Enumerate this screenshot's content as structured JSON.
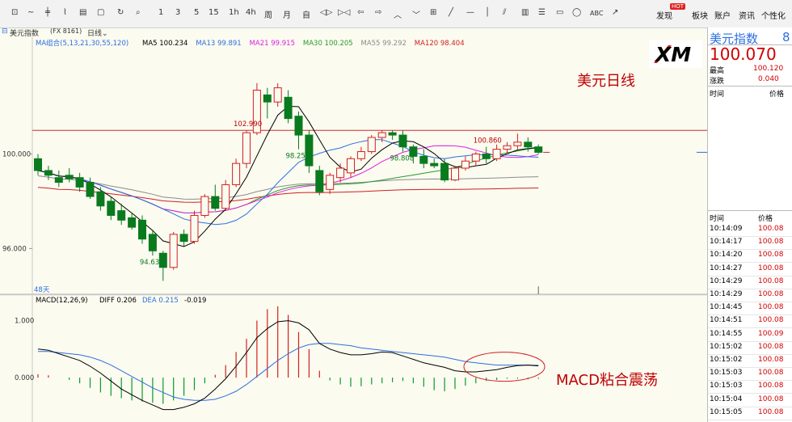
{
  "toolbar": {
    "tools": [
      "1",
      "3",
      "5",
      "15",
      "1h",
      "4h",
      "周",
      "月",
      "自"
    ],
    "abc": "ABC",
    "right": {
      "discover": "发现",
      "hot": "HOT",
      "board": "板块",
      "account": "账户",
      "news": "资讯",
      "personal": "个性化"
    }
  },
  "instrument": {
    "name": "美元指数",
    "code": "(FX 8161)",
    "period": "日线"
  },
  "legend": {
    "group_label": "MA组合(5,13,21,30,55,120)",
    "items": [
      {
        "label": "MA5 100.234",
        "color": "#000000"
      },
      {
        "label": "MA13 99.891",
        "color": "#2c6fe0"
      },
      {
        "label": "MA21 99.915",
        "color": "#e020e0"
      },
      {
        "label": "MA30 100.205",
        "color": "#2a9a2a"
      },
      {
        "label": "MA55 99.292",
        "color": "#8c8c8c"
      },
      {
        "label": "MA120 98.404",
        "color": "#d02020"
      }
    ]
  },
  "macd_legend": {
    "label": "MACD(12,26,9)",
    "diff": "DIFF 0.206",
    "dea": "DEA 0.215",
    "macd": "-0.019"
  },
  "bar_count": "48天",
  "annotations": {
    "daily": "美元日线",
    "macd": "MACD粘合震荡",
    "xm_logo": "XM"
  },
  "right_panel": {
    "title": "美元指数",
    "code": "8",
    "price": "100.070",
    "high_label": "最高",
    "high_value": "100.120",
    "change_label": "涨跌",
    "change_value": "0.040",
    "time_header": "时间",
    "price_header": "价格",
    "ticks": [
      {
        "time": "10:14:09",
        "price": "100.08"
      },
      {
        "time": "10:14:17",
        "price": "100.08"
      },
      {
        "time": "10:14:20",
        "price": "100.08"
      },
      {
        "time": "10:14:27",
        "price": "100.08"
      },
      {
        "time": "10:14:29",
        "price": "100.08"
      },
      {
        "time": "10:14:29",
        "price": "100.08"
      },
      {
        "time": "10:14:45",
        "price": "100.08"
      },
      {
        "time": "10:14:51",
        "price": "100.08"
      },
      {
        "time": "10:14:55",
        "price": "100.09"
      },
      {
        "time": "10:15:02",
        "price": "100.08"
      },
      {
        "time": "10:15:02",
        "price": "100.08"
      },
      {
        "time": "10:15:03",
        "price": "100.08"
      },
      {
        "time": "10:15:03",
        "price": "100.08"
      },
      {
        "time": "10:15:04",
        "price": "100.08"
      },
      {
        "time": "10:15:05",
        "price": "100.08"
      }
    ]
  },
  "chart_data": [
    {
      "type": "candlestick",
      "title": "美元指数 日线",
      "y_ticks": [
        "100.000",
        "96.000"
      ],
      "ylim": [
        94.2,
        104.6
      ],
      "reference_line": {
        "value": 101.0,
        "color": "#c83030"
      },
      "up_color": "#d42020",
      "down_color": "#0a7a1e",
      "price_labels": [
        {
          "text": "102.990",
          "index": 20
        },
        {
          "text": "98.255",
          "index": 25
        },
        {
          "text": "100.860",
          "index": 43
        },
        {
          "text": "98.808",
          "index": 35
        },
        {
          "text": "94.632",
          "index": 11
        }
      ],
      "candles": [
        {
          "o": 99.8,
          "h": 100.0,
          "c": 99.3,
          "l": 99.1
        },
        {
          "o": 99.3,
          "h": 99.5,
          "c": 99.1,
          "l": 98.9
        },
        {
          "o": 99.0,
          "h": 99.3,
          "c": 98.8,
          "l": 98.6
        },
        {
          "o": 99.1,
          "h": 99.4,
          "c": 98.95,
          "l": 98.8
        },
        {
          "o": 99.0,
          "h": 99.2,
          "c": 98.6,
          "l": 98.4
        },
        {
          "o": 98.8,
          "h": 99.0,
          "c": 98.2,
          "l": 98.1
        },
        {
          "o": 98.4,
          "h": 98.6,
          "c": 97.8,
          "l": 97.6
        },
        {
          "o": 98.0,
          "h": 98.2,
          "c": 97.4,
          "l": 97.2
        },
        {
          "o": 97.6,
          "h": 97.9,
          "c": 97.2,
          "l": 97.0
        },
        {
          "o": 97.3,
          "h": 97.5,
          "c": 96.9,
          "l": 96.8
        },
        {
          "o": 97.2,
          "h": 97.4,
          "c": 96.4,
          "l": 96.2
        },
        {
          "o": 96.6,
          "h": 96.8,
          "c": 95.9,
          "l": 95.7
        },
        {
          "o": 95.8,
          "h": 95.9,
          "c": 95.2,
          "l": 94.632
        },
        {
          "o": 95.2,
          "h": 96.7,
          "c": 96.6,
          "l": 95.1
        },
        {
          "o": 96.6,
          "h": 96.8,
          "c": 96.3,
          "l": 96.1
        },
        {
          "o": 96.3,
          "h": 97.6,
          "c": 97.4,
          "l": 96.2
        },
        {
          "o": 97.4,
          "h": 98.3,
          "c": 98.2,
          "l": 97.3
        },
        {
          "o": 98.2,
          "h": 98.7,
          "c": 97.7,
          "l": 97.6
        },
        {
          "o": 97.7,
          "h": 98.9,
          "c": 98.7,
          "l": 97.6
        },
        {
          "o": 98.7,
          "h": 99.8,
          "c": 99.6,
          "l": 98.6
        },
        {
          "o": 99.6,
          "h": 101.0,
          "c": 100.9,
          "l": 99.4
        },
        {
          "o": 100.9,
          "h": 103.0,
          "c": 102.7,
          "l": 100.8
        },
        {
          "o": 102.5,
          "h": 102.8,
          "c": 102.2,
          "l": 101.5
        },
        {
          "o": 102.2,
          "h": 102.99,
          "c": 102.8,
          "l": 102.0
        },
        {
          "o": 102.4,
          "h": 102.7,
          "c": 101.5,
          "l": 101.3
        },
        {
          "o": 101.6,
          "h": 101.8,
          "c": 100.8,
          "l": 100.2
        },
        {
          "o": 100.8,
          "h": 101.0,
          "c": 99.5,
          "l": 99.2
        },
        {
          "o": 99.3,
          "h": 99.5,
          "c": 98.4,
          "l": 98.255
        },
        {
          "o": 98.5,
          "h": 99.2,
          "c": 99.1,
          "l": 98.3
        },
        {
          "o": 99.0,
          "h": 99.6,
          "c": 99.4,
          "l": 98.8
        },
        {
          "o": 99.2,
          "h": 99.9,
          "c": 99.8,
          "l": 99.0
        },
        {
          "o": 99.8,
          "h": 100.3,
          "c": 100.1,
          "l": 99.7
        },
        {
          "o": 100.1,
          "h": 100.8,
          "c": 100.7,
          "l": 100.0
        },
        {
          "o": 100.7,
          "h": 101.0,
          "c": 100.9,
          "l": 100.5
        },
        {
          "o": 100.9,
          "h": 101.0,
          "c": 100.8,
          "l": 100.6
        },
        {
          "o": 100.8,
          "h": 101.0,
          "c": 100.3,
          "l": 100.1
        },
        {
          "o": 100.3,
          "h": 100.4,
          "c": 99.9,
          "l": 99.6
        },
        {
          "o": 99.9,
          "h": 100.2,
          "c": 99.6,
          "l": 99.4
        },
        {
          "o": 99.6,
          "h": 99.8,
          "c": 99.5,
          "l": 99.4
        },
        {
          "o": 99.6,
          "h": 99.8,
          "c": 98.9,
          "l": 98.808
        },
        {
          "o": 98.9,
          "h": 99.5,
          "c": 99.4,
          "l": 98.85
        },
        {
          "o": 99.4,
          "h": 99.9,
          "c": 99.7,
          "l": 99.3
        },
        {
          "o": 99.7,
          "h": 100.1,
          "c": 100.0,
          "l": 99.5
        },
        {
          "o": 100.0,
          "h": 100.3,
          "c": 99.8,
          "l": 99.6
        },
        {
          "o": 99.8,
          "h": 100.4,
          "c": 100.2,
          "l": 99.7
        },
        {
          "o": 100.2,
          "h": 100.5,
          "c": 100.35,
          "l": 100.0
        },
        {
          "o": 100.35,
          "h": 100.86,
          "c": 100.5,
          "l": 100.2
        },
        {
          "o": 100.5,
          "h": 100.7,
          "c": 100.3,
          "l": 100.1
        },
        {
          "o": 100.3,
          "h": 100.4,
          "c": 100.07,
          "l": 100.0
        }
      ]
    },
    {
      "type": "macd",
      "title": "MACD(12,26,9)",
      "y_ticks": [
        "1.000",
        "0.000"
      ],
      "ylim": [
        -0.58,
        1.32
      ],
      "histogram": [
        0.06,
        0.04,
        0.0,
        -0.04,
        -0.1,
        -0.18,
        -0.26,
        -0.32,
        -0.36,
        -0.4,
        -0.42,
        -0.44,
        -0.46,
        -0.4,
        -0.32,
        -0.22,
        -0.1,
        0.05,
        0.22,
        0.45,
        0.68,
        1.0,
        1.2,
        1.25,
        1.1,
        0.8,
        0.5,
        0.12,
        -0.05,
        -0.12,
        -0.16,
        -0.15,
        -0.12,
        -0.1,
        -0.08,
        -0.06,
        -0.1,
        -0.16,
        -0.22,
        -0.24,
        -0.2,
        -0.14,
        -0.1,
        -0.06,
        -0.04,
        -0.02,
        -0.02,
        -0.03,
        -0.02
      ],
      "diff": [
        0.5,
        0.48,
        0.42,
        0.36,
        0.3,
        0.2,
        0.08,
        -0.06,
        -0.2,
        -0.3,
        -0.4,
        -0.48,
        -0.56,
        -0.56,
        -0.52,
        -0.46,
        -0.36,
        -0.2,
        -0.02,
        0.2,
        0.44,
        0.7,
        0.86,
        0.98,
        1.0,
        0.96,
        0.84,
        0.6,
        0.5,
        0.44,
        0.4,
        0.4,
        0.42,
        0.45,
        0.44,
        0.38,
        0.32,
        0.26,
        0.22,
        0.18,
        0.12,
        0.1,
        0.1,
        0.12,
        0.14,
        0.18,
        0.21,
        0.22,
        0.206
      ],
      "dea": [
        0.46,
        0.46,
        0.44,
        0.42,
        0.4,
        0.36,
        0.3,
        0.22,
        0.12,
        0.02,
        -0.08,
        -0.18,
        -0.26,
        -0.34,
        -0.38,
        -0.4,
        -0.4,
        -0.38,
        -0.32,
        -0.24,
        -0.12,
        0.02,
        0.16,
        0.3,
        0.42,
        0.52,
        0.58,
        0.6,
        0.6,
        0.58,
        0.56,
        0.52,
        0.5,
        0.48,
        0.46,
        0.44,
        0.42,
        0.4,
        0.38,
        0.36,
        0.32,
        0.28,
        0.26,
        0.24,
        0.22,
        0.22,
        0.22,
        0.22,
        0.215
      ]
    }
  ]
}
